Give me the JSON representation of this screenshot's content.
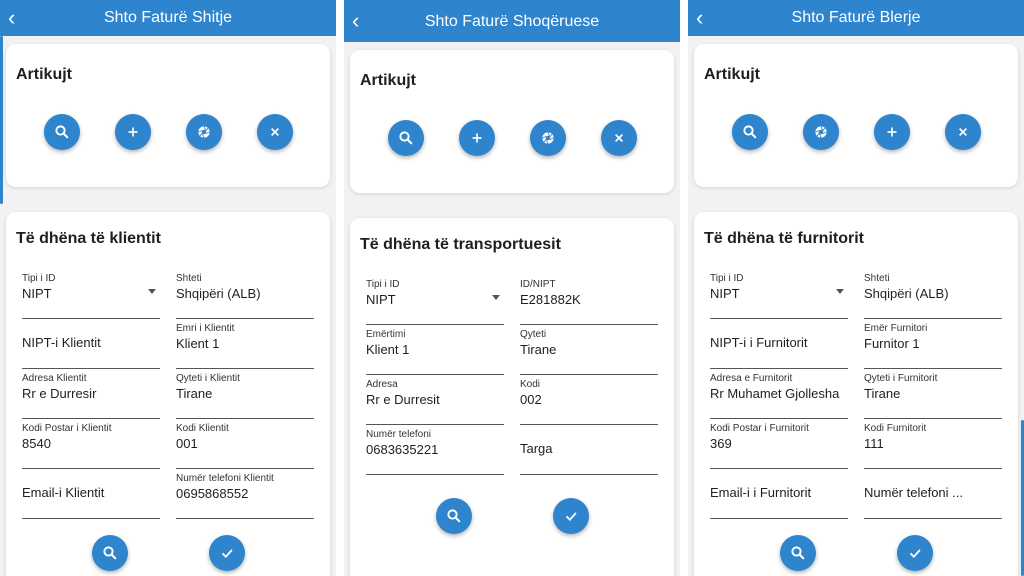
{
  "screens": [
    {
      "title": "Shto Faturë Shitje",
      "items_title": "Artikujt",
      "section_title": "Të dhëna të klientit",
      "fields": [
        {
          "label": "Tipi i ID",
          "value": "NIPT",
          "placeholder": ""
        },
        {
          "label": "Shteti",
          "value": "Shqipëri (ALB)",
          "placeholder": ""
        },
        {
          "label": "",
          "value": "",
          "placeholder": "NIPT-i Klientit"
        },
        {
          "label": "Emri i Klientit",
          "value": "Klient 1",
          "placeholder": ""
        },
        {
          "label": "Adresa Klientit",
          "value": "Rr e Durresir",
          "placeholder": ""
        },
        {
          "label": "Qyteti i Klientit",
          "value": "Tirane",
          "placeholder": ""
        },
        {
          "label": "Kodi Postar i Klientit",
          "value": "8540",
          "placeholder": ""
        },
        {
          "label": "Kodi Klientit",
          "value": "001",
          "placeholder": ""
        },
        {
          "label": "",
          "value": "",
          "placeholder": "Email-i Klientit"
        },
        {
          "label": "Numër telefoni Klientit",
          "value": "0695868552",
          "placeholder": ""
        }
      ]
    },
    {
      "title": "Shto Faturë Shoqëruese",
      "items_title": "Artikujt",
      "section_title": "Të dhëna të transportuesit",
      "fields": [
        {
          "label": "Tipi i ID",
          "value": "NIPT",
          "placeholder": ""
        },
        {
          "label": "ID/NIPT",
          "value": "E281882K",
          "placeholder": ""
        },
        {
          "label": "Emërtimi",
          "value": "Klient 1",
          "placeholder": ""
        },
        {
          "label": "Qyteti",
          "value": "Tirane",
          "placeholder": ""
        },
        {
          "label": "Adresa",
          "value": "Rr e Durresit",
          "placeholder": ""
        },
        {
          "label": "Kodi",
          "value": "002",
          "placeholder": ""
        },
        {
          "label": "Numër telefoni",
          "value": "0683635221",
          "placeholder": ""
        },
        {
          "label": "",
          "value": "",
          "placeholder": "Targa"
        }
      ]
    },
    {
      "title": "Shto Faturë Blerje",
      "items_title": "Artikujt",
      "section_title": "Të dhëna të furnitorit",
      "fields": [
        {
          "label": "Tipi i ID",
          "value": "NIPT",
          "placeholder": ""
        },
        {
          "label": "Shteti",
          "value": "Shqipëri (ALB)",
          "placeholder": ""
        },
        {
          "label": "",
          "value": "",
          "placeholder": "NIPT-i i Furnitorit"
        },
        {
          "label": "Emër Furnitori",
          "value": "Furnitor 1",
          "placeholder": ""
        },
        {
          "label": "Adresa e Furnitorit",
          "value": "Rr Muhamet Gjollesha",
          "placeholder": ""
        },
        {
          "label": "Qyteti i Furnitorit",
          "value": "Tirane",
          "placeholder": ""
        },
        {
          "label": "Kodi Postar i Furnitorit",
          "value": "369",
          "placeholder": ""
        },
        {
          "label": "Kodi Furnitorit",
          "value": "111",
          "placeholder": ""
        },
        {
          "label": "",
          "value": "",
          "placeholder": "Email-i i Furnitorit"
        },
        {
          "label": "",
          "value": "",
          "placeholder": "Numër telefoni ..."
        }
      ]
    }
  ],
  "colors": {
    "primary": "#2e84cd",
    "background": "#f2f2f4",
    "card": "#ffffff"
  },
  "icons": {
    "back": "chevron-left",
    "search": "magnifier",
    "add": "plus",
    "camera": "shutter",
    "clear": "x",
    "confirm": "check"
  }
}
